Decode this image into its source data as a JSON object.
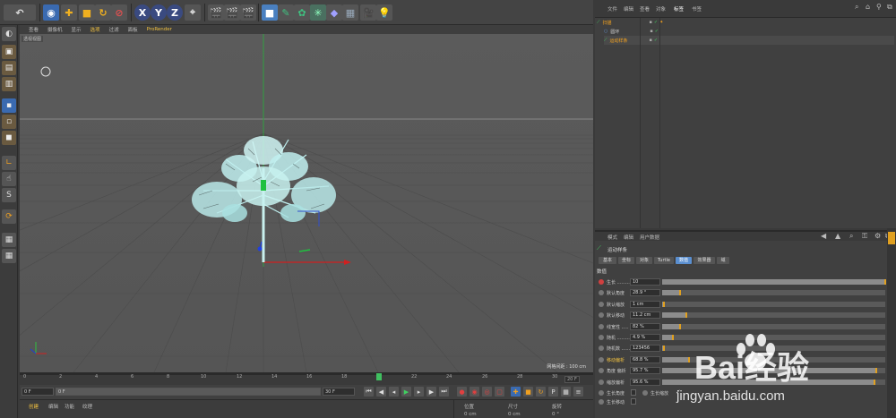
{
  "toolbar": {
    "undo_icon": "undo-icon",
    "axis_x": "X",
    "axis_y": "Y",
    "axis_z": "Z"
  },
  "viewport": {
    "menu": [
      "查看",
      "摄像机",
      "显示",
      "选项",
      "过滤",
      "面板",
      "ProRender"
    ],
    "label": "透视视图",
    "grid_info": "网格间距 : 100 cm"
  },
  "timeline": {
    "ticks": [
      "0",
      "2",
      "4",
      "6",
      "8",
      "10",
      "12",
      "14",
      "16",
      "18",
      "20",
      "22",
      "24",
      "26",
      "28",
      "30"
    ],
    "current_frame_marker": "20",
    "end_field": "20 F",
    "start_field": "0 F",
    "range_start": "0 F",
    "range_end": "30 F"
  },
  "bottom_tabs": [
    "创建",
    "编辑",
    "功能",
    "纹理"
  ],
  "coord_headers": [
    "位置",
    "尺寸",
    "旋转"
  ],
  "coord_values": [
    "0 cm",
    "0 cm",
    "0 °"
  ],
  "object_manager": {
    "menu": [
      "文件",
      "编辑",
      "查看",
      "对象",
      "标签",
      "书签"
    ],
    "objects": [
      {
        "name": "扫描",
        "highlight": true
      },
      {
        "name": "圆环",
        "highlight": false
      },
      {
        "name": "运动样条",
        "highlight": true
      }
    ]
  },
  "attribute_manager": {
    "menu": [
      "模式",
      "编辑",
      "用户数据"
    ],
    "object_name": "运动样条",
    "tabs": [
      "基本",
      "坐标",
      "对象",
      "Turtle",
      "数值",
      "效果器",
      "域"
    ],
    "active_tab": "数值",
    "section": "数值",
    "rows": [
      {
        "label": "生长 .........",
        "value": "10",
        "fill": 1.0,
        "highlight": false
      },
      {
        "label": "默认角度",
        "value": "28.9 °",
        "fill": 0.08,
        "highlight": false
      },
      {
        "label": "默认缩放",
        "value": "1 cm",
        "fill": 0.01,
        "highlight": false
      },
      {
        "label": "默认移动",
        "value": "11.2 cm",
        "fill": 0.11,
        "highlight": false
      },
      {
        "label": "线宽性 .....",
        "value": "82 %",
        "fill": 0.08,
        "highlight": false
      },
      {
        "label": "随机 .........",
        "value": "4.9 %",
        "fill": 0.05,
        "highlight": false
      },
      {
        "label": "随机数 .......",
        "value": "123456",
        "fill": 0.0,
        "highlight": false
      },
      {
        "label": "移动偏析",
        "value": "68.8 %",
        "fill": 0.12,
        "highlight": true
      },
      {
        "label": "角度 偏析",
        "value": "95.7 %",
        "fill": 0.96,
        "highlight": false
      },
      {
        "label": "缩放偏析",
        "value": "95.6 %",
        "fill": 0.95,
        "highlight": false
      }
    ],
    "check_growth_angle": "生长角度",
    "check_growth_scale": "生长缩放",
    "check_growth_move": "生长移动"
  },
  "watermark": {
    "logo": "Bai经验",
    "url": "jingyan.baidu.com"
  },
  "colors": {
    "accent_orange": "#e0a020",
    "active_tab": "#5a8fd0",
    "viewport_bg": "#595959",
    "x_axis": "#d02020",
    "y_axis": "#20c040",
    "z_axis": "#2040d0"
  }
}
